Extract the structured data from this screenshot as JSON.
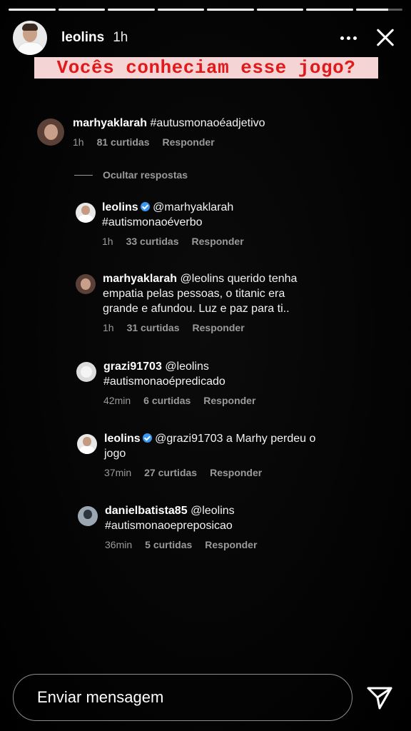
{
  "story": {
    "progress": [
      1,
      1,
      1,
      1,
      1,
      1,
      1,
      0.7
    ],
    "username": "leolins",
    "time": "1h",
    "banner": "Vocês conheciam esse jogo?"
  },
  "comments": [
    {
      "username": "marhyaklarah",
      "text": "#autusmonaoéadjetivo",
      "time": "1h",
      "likes": "81 curtidas",
      "reply": "Responder",
      "verified": false
    },
    {
      "username": "leolins",
      "text_line1": "@marhyaklarah",
      "text_line2": "#autismonaoéverbo",
      "time": "1h",
      "likes": "33 curtidas",
      "reply": "Responder",
      "verified": true
    },
    {
      "username": "marhyaklarah",
      "text_line1": "@leolins querido tenha",
      "text_line2": "empatia pelas pessoas, o titanic era",
      "text_line3": "grande e afundou. Luz e paz para ti..",
      "time": "1h",
      "likes": "31 curtidas",
      "reply": "Responder",
      "verified": false
    },
    {
      "username": "grazi91703",
      "text_line1": "@leolins",
      "text_line2": "#autismonaoépredicado",
      "time": "42min",
      "likes": "6 curtidas",
      "reply": "Responder",
      "verified": false
    },
    {
      "username": "leolins",
      "text_line1": "@grazi91703 a Marhy perdeu o",
      "text_line2": "jogo",
      "time": "37min",
      "likes": "27 curtidas",
      "reply": "Responder",
      "verified": true
    },
    {
      "username": "danielbatista85",
      "text_line1": "@leolins",
      "text_line2": "#autismonaoepreposicao",
      "time": "36min",
      "likes": "5 curtidas",
      "reply": "Responder",
      "verified": false
    }
  ],
  "hide_replies": "Ocultar respostas",
  "composer": {
    "placeholder": "Enviar mensagem"
  },
  "icons": {
    "more": "more-horizontal-icon",
    "close": "close-icon",
    "send": "paper-plane-icon",
    "verified": "verified-badge-icon"
  }
}
